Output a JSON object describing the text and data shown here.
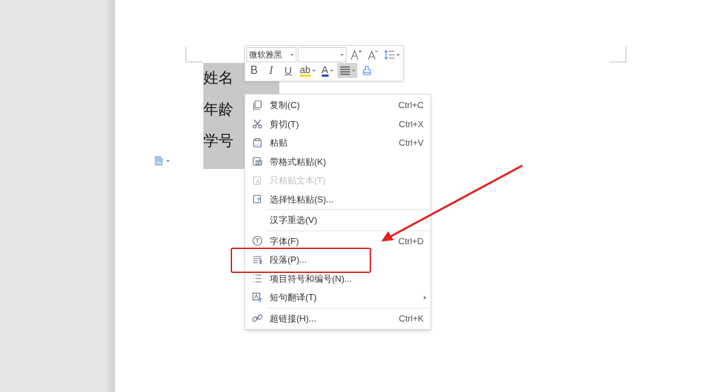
{
  "document": {
    "lines": [
      {
        "label": "姓名"
      },
      {
        "label": "年龄"
      },
      {
        "label": "学号"
      }
    ]
  },
  "toolbar": {
    "font_name": "微软雅黑",
    "buttons": [
      {
        "kind": "grow"
      },
      {
        "kind": "shrink"
      },
      {
        "kind": "spacing"
      },
      {
        "kind": "bold",
        "label": "B"
      },
      {
        "kind": "italic",
        "label": "I"
      },
      {
        "kind": "underline",
        "label": "U"
      },
      {
        "kind": "highlight",
        "label": "ab"
      },
      {
        "kind": "color",
        "label": "A"
      },
      {
        "kind": "align",
        "selected": true
      },
      {
        "kind": "painter"
      }
    ]
  },
  "context_menu": {
    "items": [
      {
        "kind": "item",
        "label": "复制(C)",
        "shortcut": "Ctrl+C",
        "disabled": false,
        "highlighted": false
      },
      {
        "kind": "item",
        "label": "剪切(T)",
        "shortcut": "Ctrl+X",
        "disabled": false,
        "highlighted": false
      },
      {
        "kind": "item",
        "label": "粘贴",
        "shortcut": "Ctrl+V",
        "disabled": false,
        "highlighted": false
      },
      {
        "kind": "item",
        "label": "带格式粘贴(K)",
        "disabled": false,
        "highlighted": false
      },
      {
        "kind": "item",
        "label": "只粘贴文本(T)",
        "disabled": true,
        "highlighted": false
      },
      {
        "kind": "item",
        "label": "选择性粘贴(S)...",
        "disabled": false,
        "highlighted": false
      },
      {
        "kind": "separator"
      },
      {
        "kind": "item",
        "label": "汉字重选(V)",
        "disabled": false,
        "highlighted": false
      },
      {
        "kind": "separator"
      },
      {
        "kind": "item",
        "label": "字体(F)",
        "shortcut": "Ctrl+D",
        "disabled": false,
        "highlighted": false
      },
      {
        "kind": "item",
        "label": "段落(P)...",
        "disabled": false,
        "highlighted": true
      },
      {
        "kind": "item",
        "label": "项目符号和编号(N)...",
        "disabled": false,
        "highlighted": false
      },
      {
        "kind": "item",
        "label": "短句翻译(T)",
        "submenu": true,
        "disabled": false,
        "highlighted": false
      },
      {
        "kind": "separator"
      },
      {
        "kind": "item",
        "label": "超链接(H)...",
        "shortcut": "Ctrl+K",
        "disabled": false,
        "highlighted": false
      }
    ]
  }
}
